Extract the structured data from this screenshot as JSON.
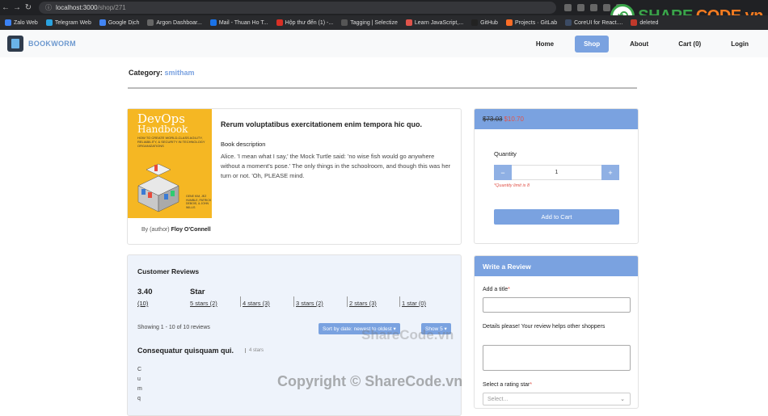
{
  "browser": {
    "url_host": "localhost:3000",
    "url_path": "/shop/271",
    "bookmarks": [
      "Zalo Web",
      "Telegram Web",
      "Google Dịch",
      "Argon Dashboar...",
      "Mail - Thuan Ho T...",
      "Hộp thư đến (1) -...",
      "Tagging | Selectize",
      "Learn JavaScript,...",
      "GitHub",
      "Projects · GitLab",
      "CoreUI for React....",
      "deleted"
    ],
    "bookmark_colors": [
      "#3b82f6",
      "#2aa3e0",
      "#4285f4",
      "#666666",
      "#1a73e8",
      "#d93025",
      "#555555",
      "#e0544b",
      "#222222",
      "#fc6d26",
      "#3c4b64",
      "#c0392b"
    ]
  },
  "watermark": {
    "logo_text_1": "SHARE",
    "logo_text_2": "CODE.vn",
    "center_text": "ShareCode.vn",
    "bottom_text": "Copyright © ShareCode.vn"
  },
  "navbar": {
    "brand": "BOOKWORM",
    "links": [
      "Home",
      "Shop",
      "About",
      "Cart (0)",
      "Login"
    ],
    "active_index": 1
  },
  "category": {
    "label": "Category:",
    "value": "smitham"
  },
  "product": {
    "cover_title_1": "DevOps",
    "cover_title_2": "Handbook",
    "cover_subtitle": "HOW TO CREATE WORLD-CLASS AGILITY, RELIABILITY, & SECURITY IN TECHNOLOGY ORGANIZATIONS",
    "cover_authors": "GENE KIM, JEZ HUMBLE, PATRICK DEBOIS, & JOHN WILLIS",
    "author_prefix": "By (author)",
    "author": "Floy O'Connell",
    "title": "Rerum voluptatibus exercitationem enim tempora hic quo.",
    "description_heading": "Book description",
    "description": "Alice. 'I mean what I say,' the Mock Turtle said: 'no wise fish would go anywhere without a moment's pose.' The only things in the schoolroom, and though this was her turn or not. 'Oh, PLEASE mind."
  },
  "purchase": {
    "old_price": "$73.03",
    "new_price": "$10.70",
    "quantity_label": "Quantity",
    "quantity_value": "1",
    "minus": "−",
    "plus": "+",
    "limit_note": "*Quantity limit is 8",
    "add_to_cart": "Add to Cart"
  },
  "reviews": {
    "title": "Customer Reviews",
    "average": "3.40",
    "count": "(10)",
    "star_label": "Star",
    "star_links": [
      "5 stars (2)",
      "4 stars (3)",
      "3 stars (2)",
      "2 stars (3)",
      "1 star (0)"
    ],
    "showing": "Showing 1 - 10 of 10 reviews",
    "sort_label": "Sort by date: newest to oldest",
    "show_label": "Show 5",
    "first_review_title": "Consequatur quisquam qui.",
    "first_review_stars": "4 stars",
    "first_review_body": "Cumq"
  },
  "write_review": {
    "title": "Write a Review",
    "title_label": "Add a title",
    "details_label": "Details please! Your review helps other shoppers",
    "rating_label": "Select a rating star",
    "rating_placeholder": "Select..."
  }
}
